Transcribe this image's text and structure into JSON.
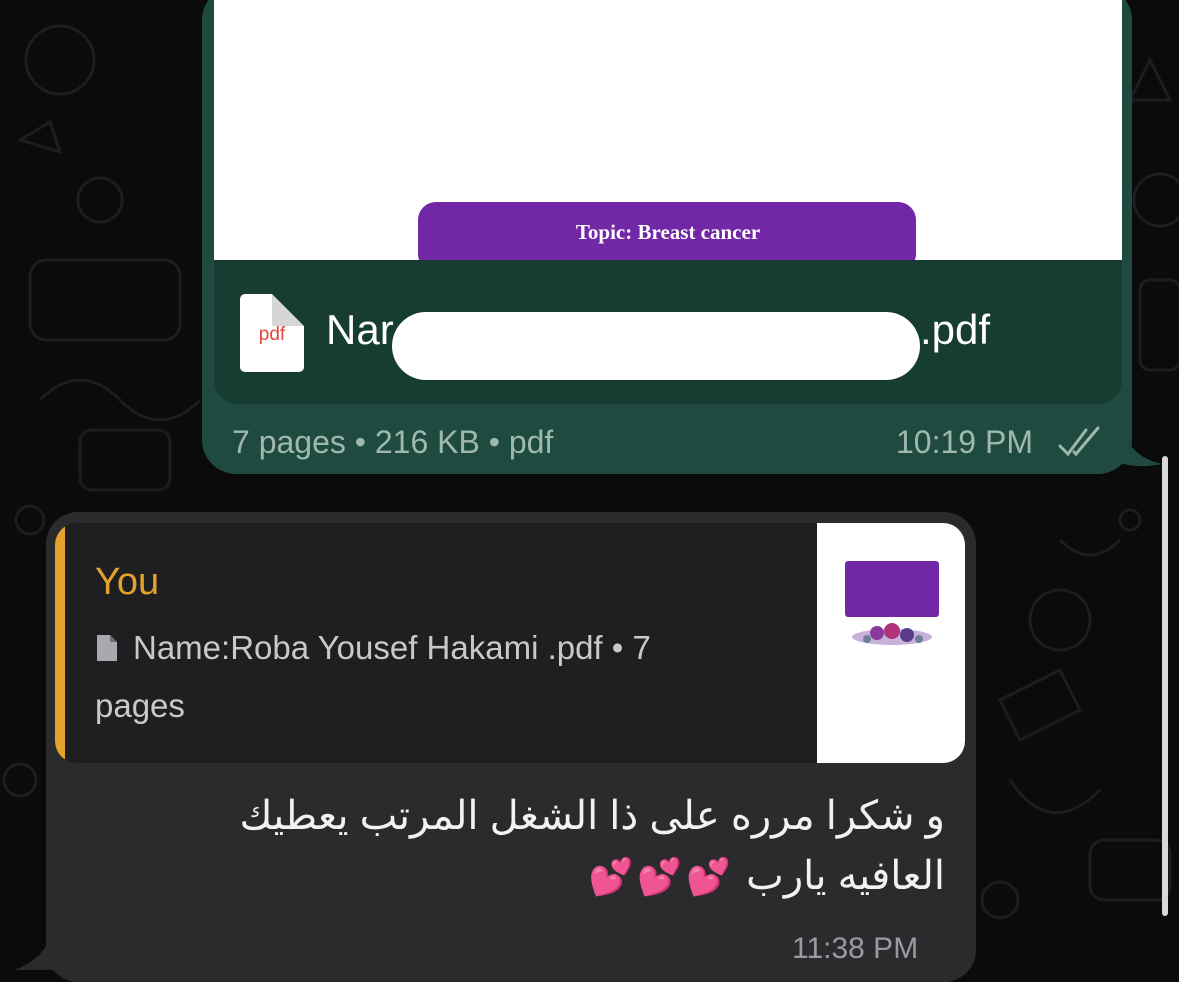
{
  "colors": {
    "outgoing_bubble": "#1f4a3f",
    "incoming_bubble": "#2b2b2e",
    "quote_accent": "#e3a32a",
    "topic_purple": "#7127a6",
    "background": "#0b0b0c"
  },
  "outgoing_message": {
    "preview_title": "Topic: Breast cancer",
    "file_icon_label": "pdf",
    "file_name_start": "Nar",
    "file_name_end": ".pdf",
    "meta": "7 pages • 216 KB • pdf",
    "time": "10:19 PM",
    "status_icon": "double-check-icon"
  },
  "incoming_message": {
    "quote": {
      "sender": "You",
      "file_line": "Name:Roba Yousef Hakami .pdf • 7",
      "file_line_2": "pages",
      "icon": "document-icon"
    },
    "text": "و شكرا مرره على ذا الشغل المرتب يعطيك العافيه يارب",
    "emoji": "💕💕💕",
    "time": "11:38 PM"
  }
}
